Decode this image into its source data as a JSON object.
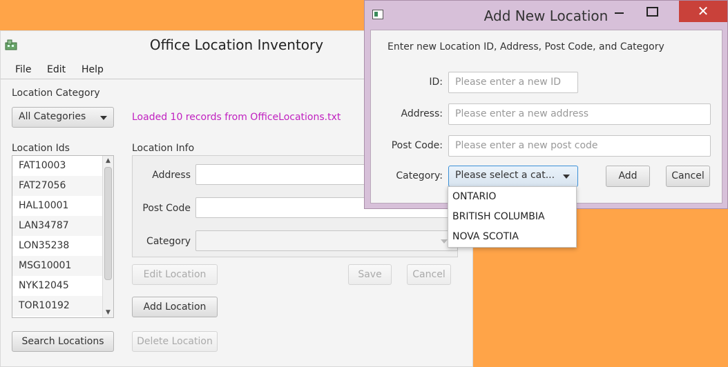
{
  "main_window": {
    "title": "Office Location Inventory",
    "menu": [
      "File",
      "Edit",
      "Help"
    ],
    "category_label": "Location Category",
    "category_value": "All Categories",
    "status_message": "Loaded 10 records from OfficeLocations.txt",
    "ids_label": "Location Ids",
    "location_ids": [
      "FAT10003",
      "FAT27056",
      "HAL10001",
      "LAN34787",
      "LON35238",
      "MSG10001",
      "NYK12045",
      "TOR10192"
    ],
    "info_label": "Location Info",
    "address_label": "Address",
    "post_code_label": "Post Code",
    "category_field_label": "Category",
    "edit_button": "Edit Location",
    "save_button": "Save",
    "cancel_button": "Cancel",
    "add_button": "Add Location",
    "search_button": "Search Locations",
    "delete_button": "Delete Location"
  },
  "dialog": {
    "title": "Add New Location",
    "instruction": "Enter new Location ID, Address, Post Code, and Category",
    "id_label": "ID:",
    "id_placeholder": "Please enter a new ID",
    "address_label": "Address:",
    "address_placeholder": "Please enter a new address",
    "post_code_label": "Post Code:",
    "post_code_placeholder": "Please enter a new post code",
    "category_label": "Category:",
    "category_value": "Please select a cat...",
    "add_button": "Add",
    "cancel_button": "Cancel",
    "close_glyph": "✕",
    "category_options": [
      "ONTARIO",
      "BRITISH COLUMBIA",
      "NOVA SCOTIA"
    ]
  },
  "colors": {
    "background": "#FFA448",
    "status_text": "#C020C0",
    "dialog_frame": "#D7C0D9",
    "close_button": "#C9413A"
  }
}
